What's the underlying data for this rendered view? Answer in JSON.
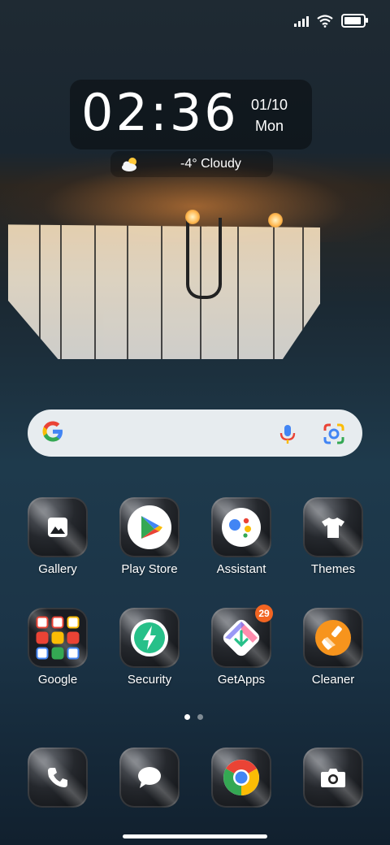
{
  "status_bar": {
    "icons": [
      "signal-icon",
      "wifi-icon",
      "battery-icon"
    ],
    "battery_level": 0.9
  },
  "clock_widget": {
    "time": "02:36",
    "date": "01/10",
    "day": "Mon",
    "weather_icon": "partly-cloudy-icon",
    "weather": "-4° Cloudy"
  },
  "search_bar": {
    "logo_letter": "G",
    "icons": [
      "google-logo",
      "microphone-icon",
      "google-lens-icon"
    ]
  },
  "apps": [
    {
      "label": "Gallery",
      "icon": "gallery-icon"
    },
    {
      "label": "Play Store",
      "icon": "play-store-icon"
    },
    {
      "label": "Assistant",
      "icon": "assistant-icon"
    },
    {
      "label": "Themes",
      "icon": "themes-icon"
    },
    {
      "label": "Google",
      "icon": "google-folder-icon"
    },
    {
      "label": "Security",
      "icon": "security-icon"
    },
    {
      "label": "GetApps",
      "icon": "getapps-icon",
      "badge": "29"
    },
    {
      "label": "Cleaner",
      "icon": "cleaner-icon"
    }
  ],
  "page_indicator": {
    "pages": 2,
    "current": 1
  },
  "dock": [
    {
      "icon": "phone-icon"
    },
    {
      "icon": "messages-icon"
    },
    {
      "icon": "chrome-icon"
    },
    {
      "icon": "camera-icon"
    }
  ],
  "colors": {
    "badge": "#f26522",
    "search_bg": "#e7ecef"
  }
}
